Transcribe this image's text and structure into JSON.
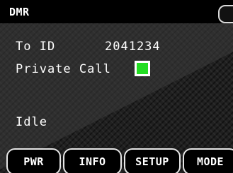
{
  "status_bar": {
    "mode": "DMR"
  },
  "call": {
    "to_id_label": "To ID",
    "to_id_value": "2041234",
    "private_label": "Private Call",
    "private_enabled": true,
    "private_color": "#22dd22",
    "status": "Idle"
  },
  "softkeys": {
    "pwr": "PWR",
    "info": "INFO",
    "setup": "SETUP",
    "mode": "MODE"
  }
}
